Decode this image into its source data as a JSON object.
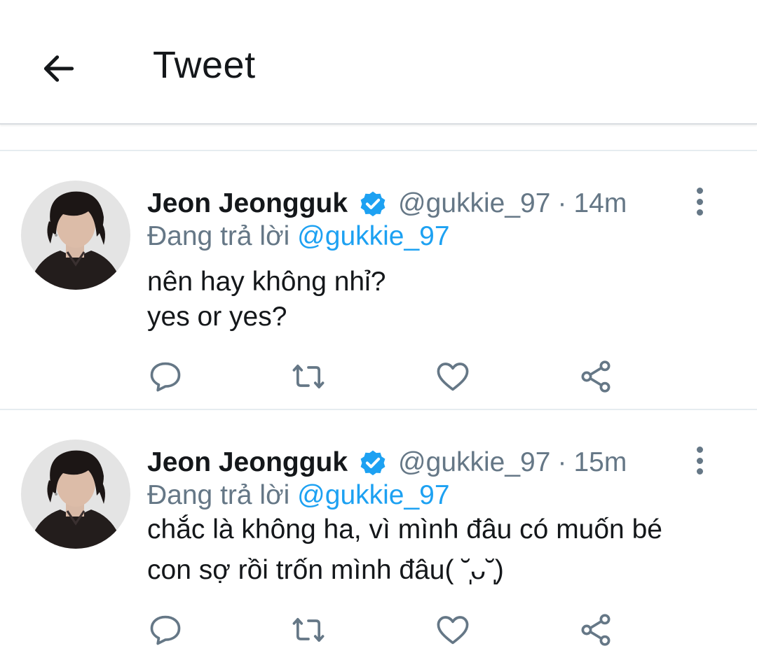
{
  "header": {
    "title": "Tweet"
  },
  "colors": {
    "accent": "#1da1f2",
    "secondary_text": "#657786",
    "primary_text": "#14171a",
    "divider": "#e6ecf0"
  },
  "tweets": [
    {
      "author_name": "Jeon Jeongguk",
      "verified": true,
      "handle": "@gukkie_97",
      "separator": "·",
      "time": "14m",
      "reply_prefix": "Đang trả lời",
      "reply_mention": "@gukkie_97",
      "lines": [
        "nên hay không nhỉ?",
        "yes or yes?"
      ],
      "actions": [
        "reply-icon",
        "retweet-icon",
        "like-icon",
        "share-icon"
      ]
    },
    {
      "author_name": "Jeon Jeongguk",
      "verified": true,
      "handle": "@gukkie_97",
      "separator": "·",
      "time": "15m",
      "reply_prefix": "Đang trả lời",
      "reply_mention": "@gukkie_97",
      "lines": [
        "chắc là không ha, vì mình đâu có muốn bé",
        "con sợ rồi trốn mình đâu( ˘̩̩̩ᴗ˘̩̩̩)"
      ],
      "actions": [
        "reply-icon",
        "retweet-icon",
        "like-icon",
        "share-icon"
      ]
    }
  ]
}
